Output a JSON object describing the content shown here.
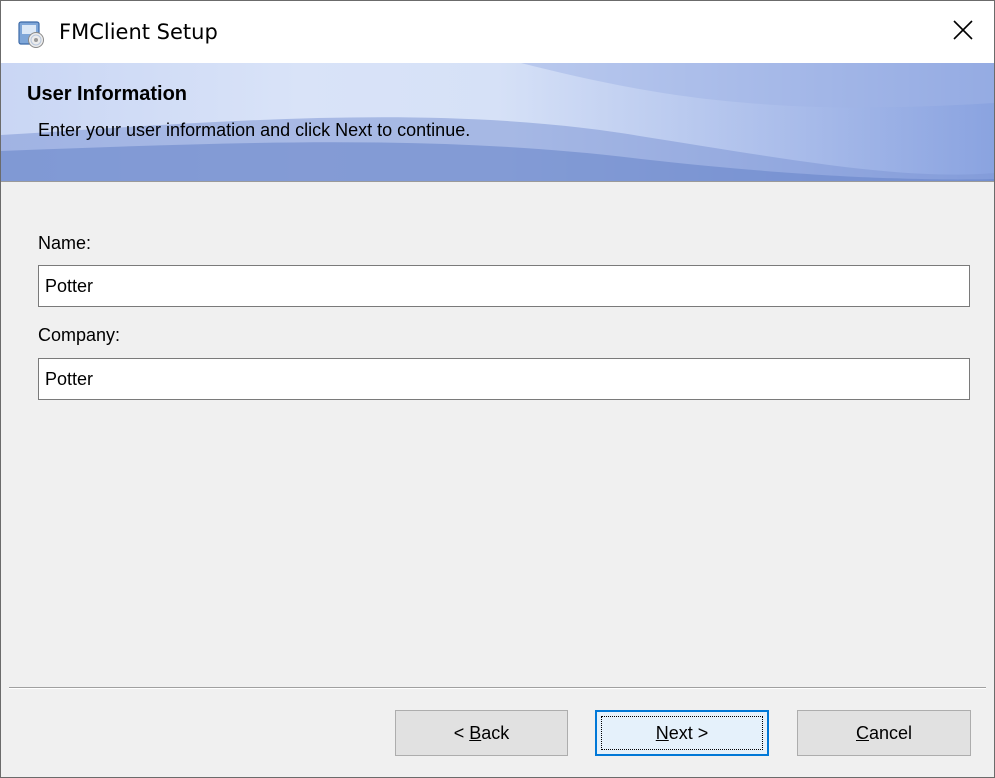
{
  "window": {
    "title": "FMClient Setup"
  },
  "banner": {
    "heading": "User Information",
    "subtitle": "Enter your user information and click Next to continue."
  },
  "form": {
    "name_label": "Name:",
    "name_value": "Potter",
    "company_label": "Company:",
    "company_value": "Potter"
  },
  "buttons": {
    "back": {
      "prefix": "< ",
      "mnemonic": "B",
      "rest": "ack"
    },
    "next": {
      "mnemonic": "N",
      "rest": "ext >"
    },
    "cancel": {
      "mnemonic": "C",
      "rest": "ancel"
    }
  },
  "icons": {
    "app": "installer-icon",
    "close": "close-icon"
  },
  "colors": {
    "accent": "#0078d7",
    "banner_light": "#d9e3f8",
    "banner_dark": "#8aa3e0"
  }
}
